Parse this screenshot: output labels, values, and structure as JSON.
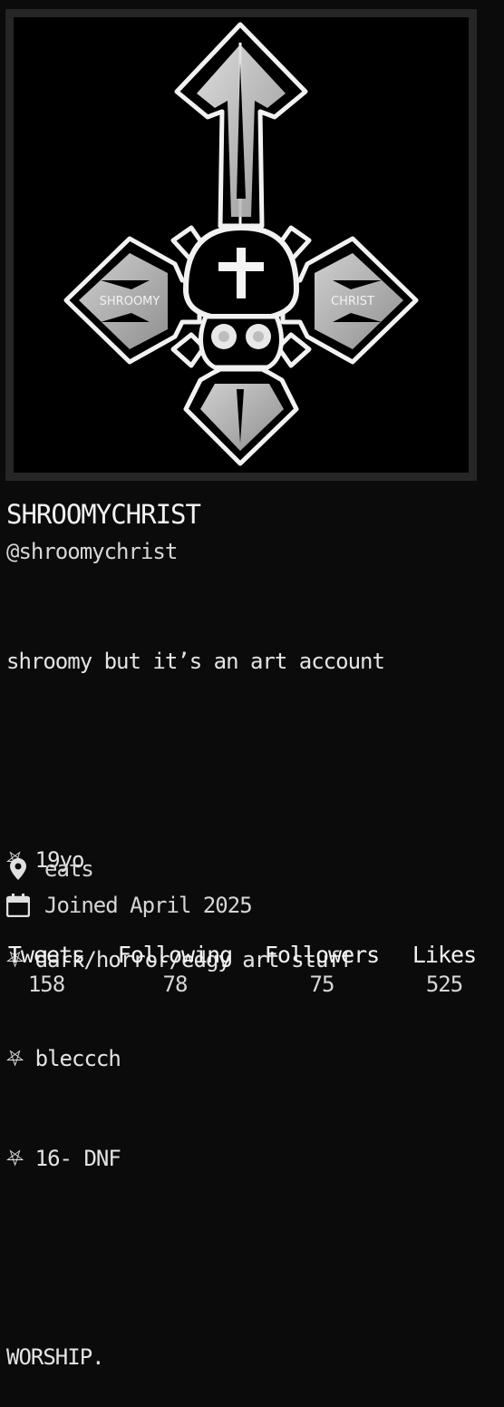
{
  "profile": {
    "avatar_text_left": "SHROOMY",
    "avatar_text_right": "CHRIST",
    "display_name": "SHROOMYCHRIST",
    "handle": "@shroomychrist",
    "bio": {
      "intro": "shroomy but it’s an art account",
      "bullets": [
        "⛧ 19yo",
        "⛧ dark/horror/edgy art stuff",
        "⛧ bleccch",
        "⛧ 16- DNF"
      ],
      "closing": "WORSHIP."
    },
    "location": "eats",
    "joined": "Joined April 2025",
    "location_icon": "map-pin-icon",
    "joined_icon": "calendar-icon"
  },
  "stats": [
    {
      "label": "Tweets",
      "value": "158"
    },
    {
      "label": "Following",
      "value": "78"
    },
    {
      "label": "Followers",
      "value": "75"
    },
    {
      "label": "Likes",
      "value": "525"
    }
  ],
  "colors": {
    "background": "#0b0b0b",
    "frame": "#262626",
    "text": "#e9e9e9"
  }
}
